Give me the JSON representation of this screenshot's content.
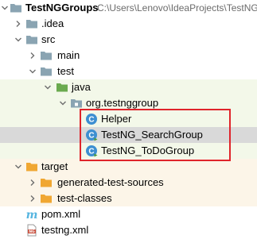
{
  "project": {
    "name": "TestNGGroups",
    "path": "C:\\Users\\Lenovo\\IdeaProjects\\TestNG"
  },
  "tree": {
    "idea": "idea",
    "src": "src",
    "main": "main",
    "test": "test",
    "java": "java",
    "package": "org.testnggroup",
    "classes": [
      {
        "label": "Helper"
      },
      {
        "label": "TestNG_SearchGroup"
      },
      {
        "label": "TestNG_ToDoGroup"
      }
    ],
    "target": "target",
    "generated_test_sources": "generated-test-sources",
    "test_classes": "test-classes",
    "pom": "pom.xml",
    "testng": "testng.xml"
  },
  "colors": {
    "folder": "#8aa4b2",
    "source_folder": "#56b5e0",
    "test_folder": "#6aaa4e",
    "excluded_folder": "#f0a732",
    "highlight": "#e0242b",
    "class_icon": "#3d8fd1"
  },
  "icons": {
    "collapse_arrow": "chevron-down-icon",
    "expand_arrow": "chevron-right-icon",
    "folder": "folder-icon",
    "package": "package-icon",
    "class": "java-class-icon",
    "maven": "maven-icon",
    "testng": "testng-file-icon"
  }
}
